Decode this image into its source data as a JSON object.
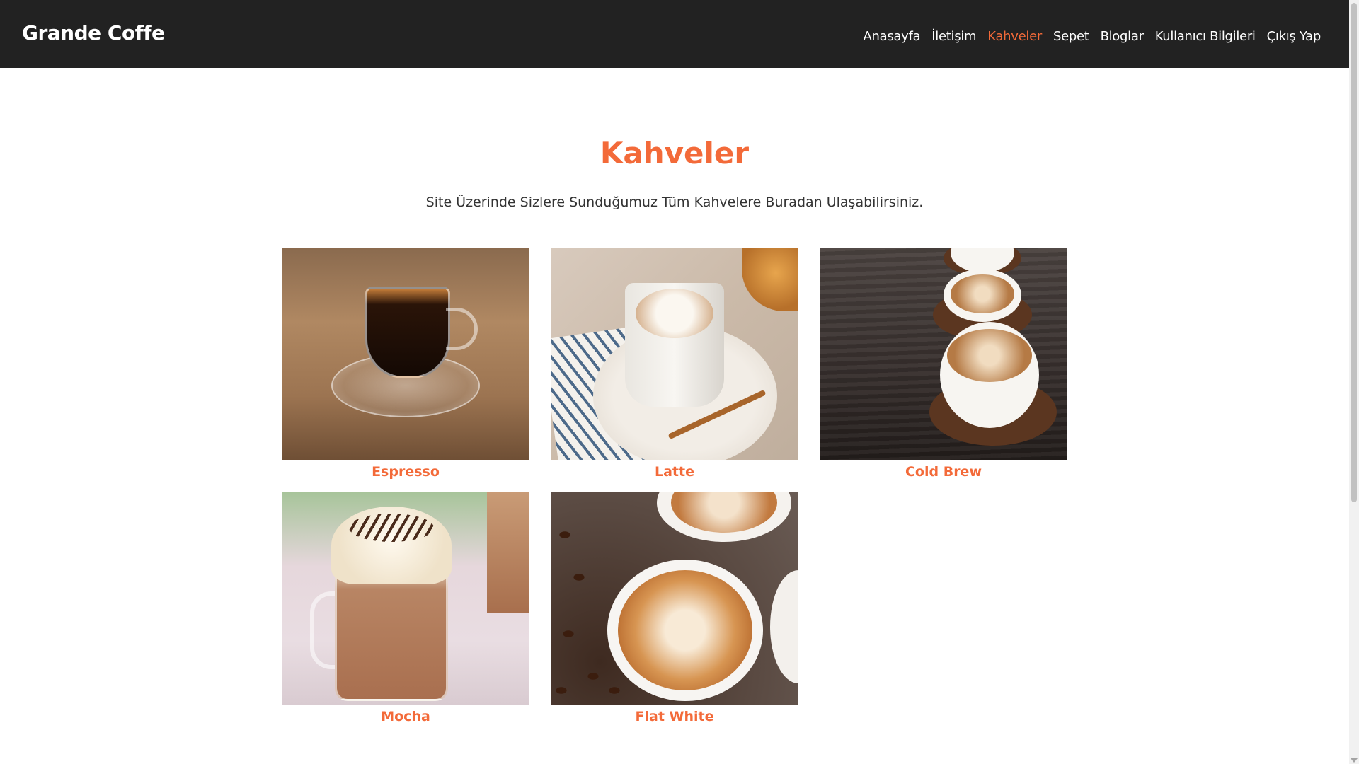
{
  "brand": "Grande Coffe",
  "nav": [
    {
      "label": "Anasayfa",
      "active": false
    },
    {
      "label": "İletişim",
      "active": false
    },
    {
      "label": "Kahveler",
      "active": true
    },
    {
      "label": "Sepet",
      "active": false
    },
    {
      "label": "Bloglar",
      "active": false
    },
    {
      "label": "Kullanıcı Bilgileri",
      "active": false
    },
    {
      "label": "Çıkış Yap",
      "active": false
    }
  ],
  "page": {
    "title": "Kahveler",
    "subtitle": "Site Üzerinde Sizlere Sunduğumuz Tüm Kahvelere Buradan Ulaşabilirsiniz."
  },
  "products": [
    {
      "name": "Espresso"
    },
    {
      "name": "Latte"
    },
    {
      "name": "Cold Brew"
    },
    {
      "name": "Mocha"
    },
    {
      "name": "Flat White"
    }
  ],
  "colors": {
    "accent": "#f36a39",
    "navbar_bg": "#222222",
    "page_bg": "#ffffff"
  }
}
